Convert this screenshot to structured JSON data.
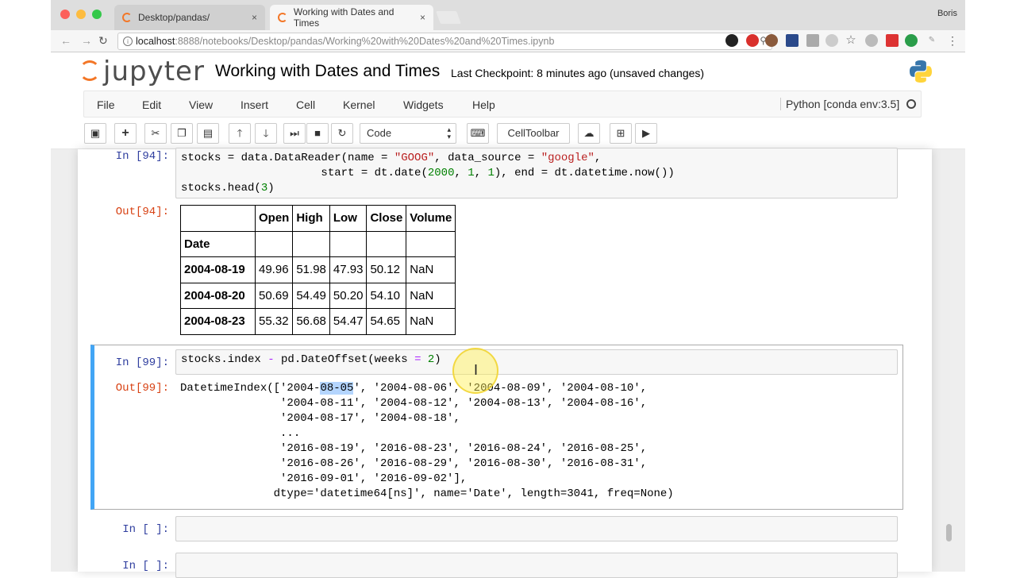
{
  "browser": {
    "tabs": [
      {
        "label": "Desktop/pandas/",
        "close": "×"
      },
      {
        "label": "Working with Dates and Times",
        "close": "×"
      }
    ],
    "user": "Boris",
    "url_host": "localhost",
    "url_rest": ":8888/notebooks/Desktop/pandas/Working%20with%20Dates%20and%20Times.ipynb",
    "nav": {
      "back": "←",
      "forward": "→",
      "reload": "↻"
    }
  },
  "jupyter": {
    "logo_text": "jupyter",
    "notebook_title": "Working with Dates and Times",
    "checkpoint": "Last Checkpoint: 8 minutes ago (unsaved changes)",
    "menu": [
      "File",
      "Edit",
      "View",
      "Insert",
      "Cell",
      "Kernel",
      "Widgets",
      "Help"
    ],
    "kernel": "Python [conda env:3.5]",
    "toolbar": {
      "cell_type": "Code",
      "celltoolbar_label": "CellToolbar"
    }
  },
  "cells": {
    "c94": {
      "in_prompt": "In [94]:",
      "out_prompt": "Out[94]:",
      "table": {
        "columns": [
          "Open",
          "High",
          "Low",
          "Close",
          "Volume"
        ],
        "index_name": "Date",
        "rows": [
          {
            "date": "2004-08-19",
            "values": [
              "49.96",
              "51.98",
              "47.93",
              "50.12",
              "NaN"
            ]
          },
          {
            "date": "2004-08-20",
            "values": [
              "50.69",
              "54.49",
              "50.20",
              "54.10",
              "NaN"
            ]
          },
          {
            "date": "2004-08-23",
            "values": [
              "55.32",
              "56.68",
              "54.47",
              "54.65",
              "NaN"
            ]
          }
        ]
      }
    },
    "c99": {
      "in_prompt": "In [99]:",
      "out_prompt": "Out[99]:"
    },
    "empty1": {
      "in_prompt": "In [ ]:"
    },
    "empty2": {
      "in_prompt": "In [ ]:"
    }
  }
}
